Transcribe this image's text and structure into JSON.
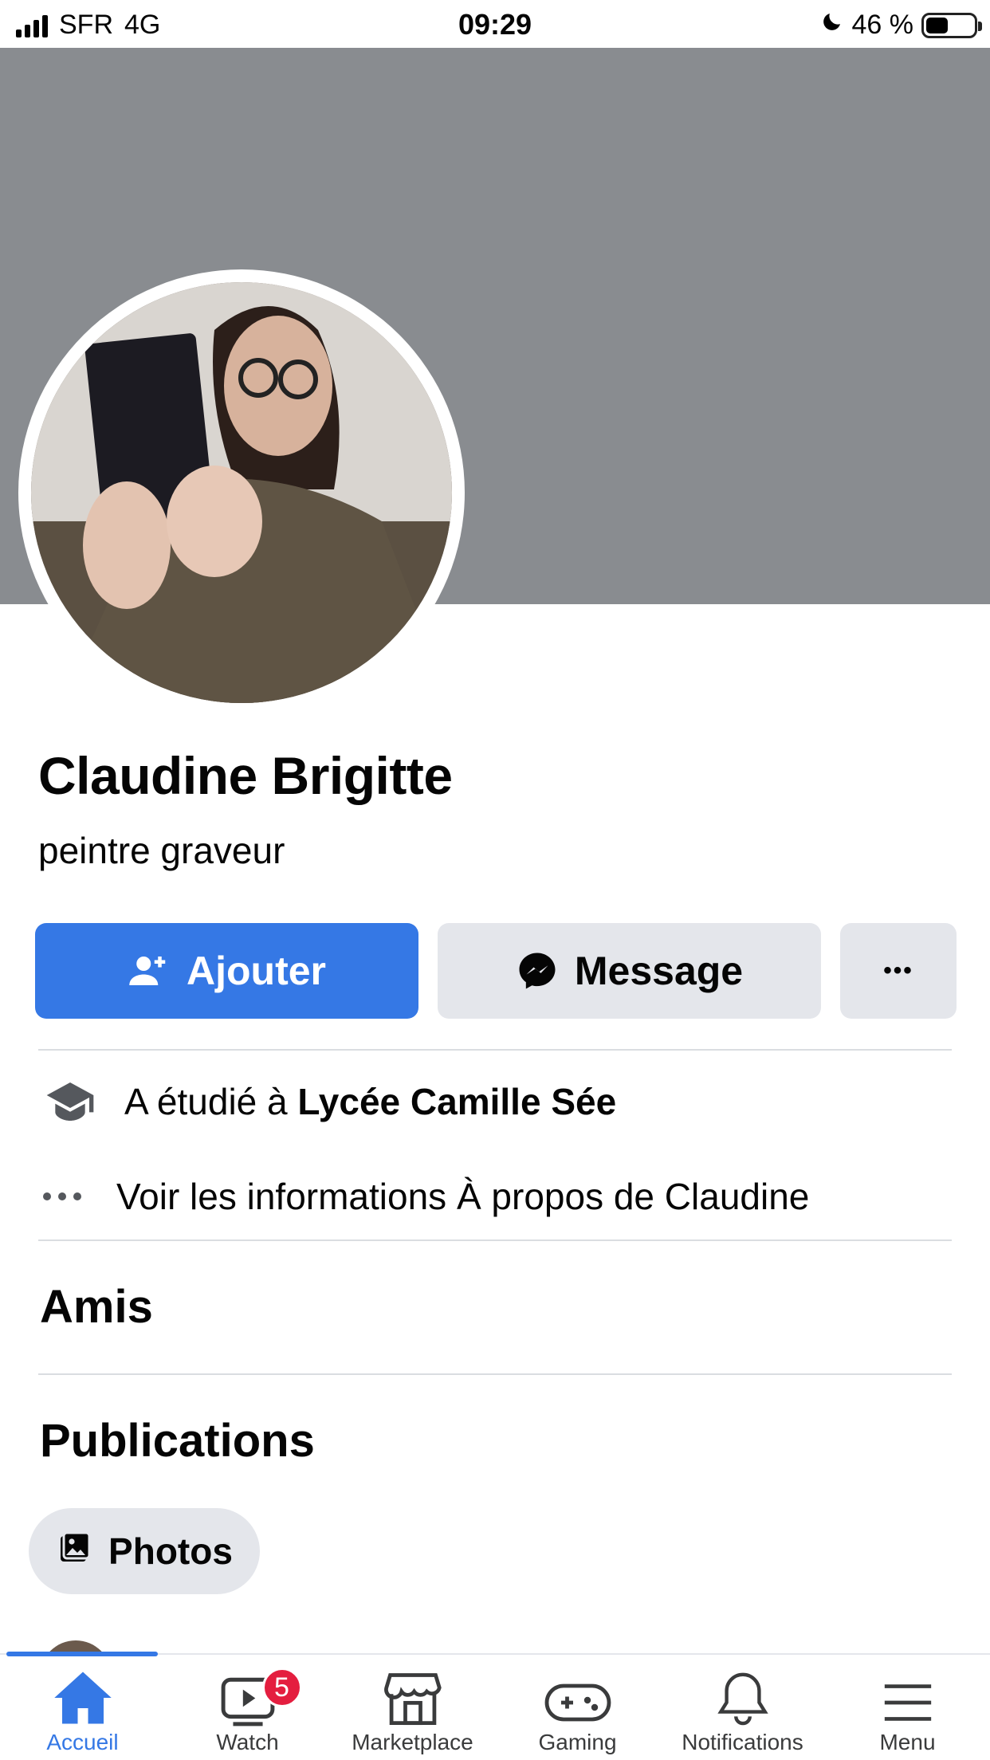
{
  "status_bar": {
    "carrier": "SFR",
    "network": "4G",
    "time": "09:29",
    "battery": "46 %",
    "battery_level": 0.46
  },
  "profile": {
    "name": "Claudine Brigitte",
    "bio": "peintre graveur"
  },
  "actions": {
    "add_label": "Ajouter",
    "message_label": "Message",
    "more_label": "•••"
  },
  "info": {
    "studied_prefix": "A étudié à ",
    "studied_school": "Lycée Camille Sée",
    "more_info": "Voir les informations À propos de Claudine"
  },
  "sections": {
    "friends": "Amis",
    "posts": "Publications"
  },
  "chips": {
    "photos": "Photos"
  },
  "tabbar": {
    "tabs": [
      {
        "label": "Accueil",
        "icon": "home-icon",
        "active": true
      },
      {
        "label": "Watch",
        "icon": "watch-icon",
        "badge": "5"
      },
      {
        "label": "Marketplace",
        "icon": "marketplace-icon"
      },
      {
        "label": "Gaming",
        "icon": "gaming-icon"
      },
      {
        "label": "Notifications",
        "icon": "bell-icon"
      },
      {
        "label": "Menu",
        "icon": "menu-icon"
      }
    ]
  },
  "colors": {
    "brand_blue": "#3578e5",
    "button_gray": "#e4e6eb",
    "cover_gray": "#898c90",
    "badge_red": "#e41e3f"
  }
}
